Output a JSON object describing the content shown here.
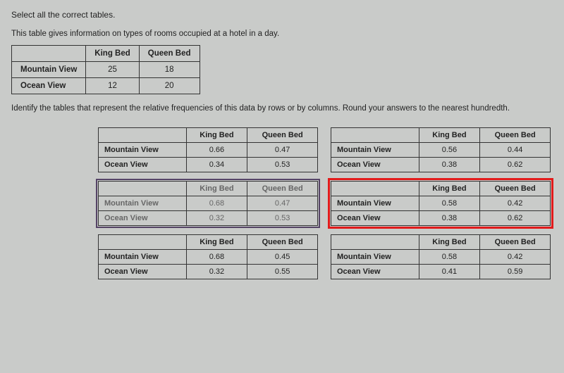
{
  "heading": "Select all the correct tables.",
  "description": "This table gives information on types of rooms occupied at a hotel in a day.",
  "instruction": "Identify the tables that represent the relative frequencies of this data by rows or by columns. Round your answers to the nearest hundredth.",
  "cols": {
    "c1": "King Bed",
    "c2": "Queen Bed"
  },
  "rows": {
    "r1": "Mountain View",
    "r2": "Ocean View"
  },
  "source": {
    "r1c1": "25",
    "r1c2": "18",
    "r2c1": "12",
    "r2c2": "20"
  },
  "options": [
    {
      "r1c1": "0.66",
      "r1c2": "0.47",
      "r2c1": "0.34",
      "r2c2": "0.53"
    },
    {
      "r1c1": "0.56",
      "r1c2": "0.44",
      "r2c1": "0.38",
      "r2c2": "0.62"
    },
    {
      "r1c1": "0.68",
      "r1c2": "0.47",
      "r2c1": "0.32",
      "r2c2": "0.53"
    },
    {
      "r1c1": "0.58",
      "r1c2": "0.42",
      "r2c1": "0.38",
      "r2c2": "0.62"
    },
    {
      "r1c1": "0.68",
      "r1c2": "0.45",
      "r2c1": "0.32",
      "r2c2": "0.55"
    },
    {
      "r1c1": "0.58",
      "r1c2": "0.42",
      "r2c1": "0.41",
      "r2c2": "0.59"
    }
  ]
}
